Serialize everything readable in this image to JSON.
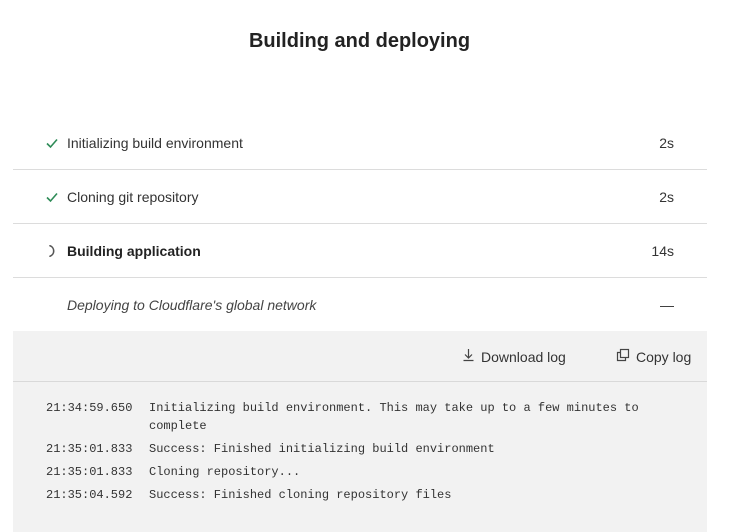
{
  "header": {
    "title": "Building and deploying"
  },
  "steps": [
    {
      "label": "Initializing build environment",
      "duration": "2s",
      "status": "done",
      "icon": "check-icon"
    },
    {
      "label": "Cloning git repository",
      "duration": "2s",
      "status": "done",
      "icon": "check-icon"
    },
    {
      "label": "Building application",
      "duration": "14s",
      "status": "in-progress",
      "icon": "spinner-icon"
    },
    {
      "label": "Deploying to Cloudflare's global network",
      "duration": "—",
      "status": "pending"
    }
  ],
  "log_toolbar": {
    "download_label": "Download log",
    "download_icon": "download-icon",
    "copy_label": "Copy log",
    "copy_icon": "copy-icon"
  },
  "log": [
    {
      "time": "21:34:59.650",
      "message": "Initializing build environment. This may take up to a few minutes to complete"
    },
    {
      "time": "21:35:01.833",
      "message": "Success: Finished initializing build environment"
    },
    {
      "time": "21:35:01.833",
      "message": "Cloning repository..."
    },
    {
      "time": "21:35:04.592",
      "message": "Success: Finished cloning repository files"
    }
  ],
  "colors": {
    "success": "#2e8b57",
    "panel_bg": "#f2f2f2",
    "divider": "#dcdcdc"
  }
}
